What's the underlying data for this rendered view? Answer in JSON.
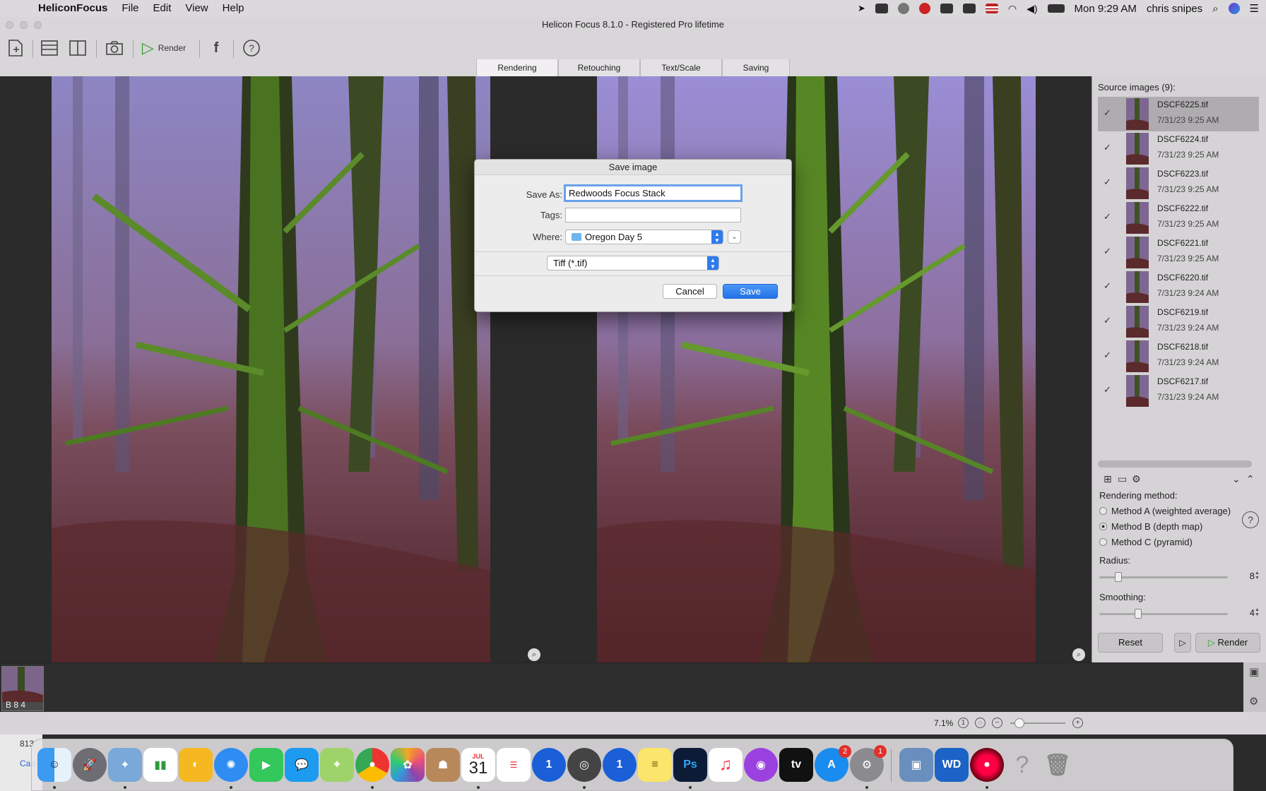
{
  "menubar": {
    "app_name": "HeliconFocus",
    "menus": [
      "File",
      "Edit",
      "View",
      "Help"
    ],
    "clock": "Mon 9:29 AM",
    "user": "chris snipes"
  },
  "window": {
    "title": "Helicon Focus 8.1.0 - Registered Pro lifetime"
  },
  "toolbar": {
    "render_label": "Render"
  },
  "tabs": [
    {
      "label": "Rendering"
    },
    {
      "label": "Retouching"
    },
    {
      "label": "Text/Scale"
    },
    {
      "label": "Saving"
    }
  ],
  "source_panel": {
    "heading": "Source images (9):",
    "items": [
      {
        "name": "DSCF6225.tif",
        "date": "7/31/23 9:25 AM",
        "checked": "✓"
      },
      {
        "name": "DSCF6224.tif",
        "date": "7/31/23 9:25 AM",
        "checked": "✓"
      },
      {
        "name": "DSCF6223.tif",
        "date": "7/31/23 9:25 AM",
        "checked": "✓"
      },
      {
        "name": "DSCF6222.tif",
        "date": "7/31/23 9:25 AM",
        "checked": "✓"
      },
      {
        "name": "DSCF6221.tif",
        "date": "7/31/23 9:25 AM",
        "checked": "✓"
      },
      {
        "name": "DSCF6220.tif",
        "date": "7/31/23 9:24 AM",
        "checked": "✓"
      },
      {
        "name": "DSCF6219.tif",
        "date": "7/31/23 9:24 AM",
        "checked": "✓"
      },
      {
        "name": "DSCF6218.tif",
        "date": "7/31/23 9:24 AM",
        "checked": "✓"
      },
      {
        "name": "DSCF6217.tif",
        "date": "7/31/23 9:24 AM",
        "checked": "✓"
      }
    ]
  },
  "rendering": {
    "method_label": "Rendering method:",
    "methods": [
      {
        "label": "Method A (weighted average)",
        "selected": false
      },
      {
        "label": "Method B (depth map)",
        "selected": true
      },
      {
        "label": "Method C (pyramid)",
        "selected": false
      }
    ],
    "radius_label": "Radius:",
    "radius_value": "8",
    "radius_fraction": 0.15,
    "smoothing_label": "Smoothing:",
    "smoothing_value": "4",
    "smoothing_fraction": 0.3,
    "reset_label": "Reset",
    "render_label": "Render"
  },
  "filmstrip": {
    "label": "B 8 4"
  },
  "statusbar": {
    "zoom": "7.1%"
  },
  "dialog": {
    "title": "Save image",
    "save_as_label": "Save As:",
    "save_as_value": "Redwoods Focus Stack",
    "tags_label": "Tags:",
    "tags_value": "",
    "where_label": "Where:",
    "where_value": "Oregon Day 5",
    "format_value": "Tiff (*.tif)",
    "cancel_label": "Cancel",
    "save_label": "Save"
  },
  "background_window": {
    "line1": "813",
    "line2": "Cap"
  },
  "dock": {
    "calendar_month": "JUL",
    "calendar_day": "31",
    "photoshop_label": "Ps",
    "tv_label": "tv",
    "wd_label": "WD",
    "appstore_badge": "2",
    "prefs_badge": "1"
  },
  "colors": {
    "accent": "#2d7bf0",
    "render_green": "#35a335",
    "panel_bg": "#d5d3d5"
  }
}
